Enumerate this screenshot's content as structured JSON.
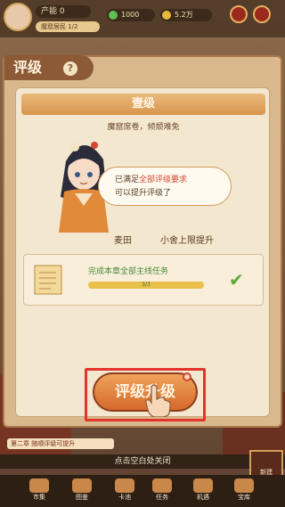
{
  "topbar": {
    "capacity_label": "产能",
    "capacity_value": "0",
    "level_label": "魔窟居民 1/2",
    "resource_1": "1000",
    "resource_2": "5.2万"
  },
  "modal": {
    "title": "评级",
    "help": "?",
    "grade": "壹级",
    "subtitle": "魔窟席卷，倾颓难免",
    "bubble": {
      "line1_prefix": "已满足",
      "line1_highlight": "全部评级要求",
      "line2": "可以提升评级了"
    },
    "rewards": [
      {
        "label": "麦田"
      },
      {
        "label": "小舍上限提升"
      }
    ],
    "task": {
      "label": "完成本章全部主线任务",
      "progress_text": "3/3",
      "progress_fraction": 1.0
    },
    "upgrade_button": "评级升级"
  },
  "notices": {
    "line1": "第二章    随顺评级可提升",
    "close_hint": "点击空白处关闭"
  },
  "bottom_nav": [
    {
      "label": "市集"
    },
    {
      "label": "图鉴"
    },
    {
      "label": "卡池"
    },
    {
      "label": "任务"
    },
    {
      "label": "机遇"
    },
    {
      "label": "宝库"
    }
  ],
  "home_button": "新建"
}
